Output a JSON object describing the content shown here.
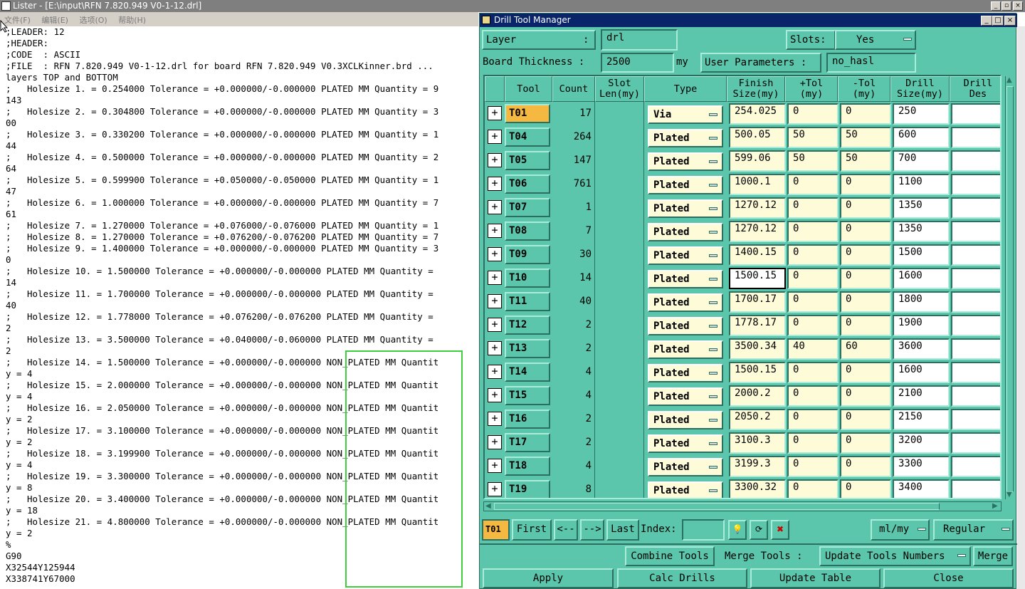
{
  "lister": {
    "title": "Lister - [E:\\input\\RFN 7.820.949 V0-1-12.drl]",
    "menu": [
      "文件(F)",
      "编辑(E)",
      "选项(O)",
      "帮助(H)"
    ],
    "lines": [
      ";LEADER: 12",
      ";HEADER:",
      ";CODE  : ASCII",
      ";FILE  : RFN 7.820.949 V0-1-12.drl for board RFN 7.820.949 V0.3XCLKinner.brd ...",
      "layers TOP and BOTTOM",
      ";   Holesize 1. = 0.254000 Tolerance = +0.000000/-0.000000 PLATED MM Quantity = 9",
      "143",
      ";   Holesize 2. = 0.304800 Tolerance = +0.000000/-0.000000 PLATED MM Quantity = 3",
      "00",
      ";   Holesize 3. = 0.330200 Tolerance = +0.000000/-0.000000 PLATED MM Quantity = 1",
      "44",
      ";   Holesize 4. = 0.500000 Tolerance = +0.000000/-0.000000 PLATED MM Quantity = 2",
      "64",
      ";   Holesize 5. = 0.599900 Tolerance = +0.050000/-0.050000 PLATED MM Quantity = 1",
      "47",
      ";   Holesize 6. = 1.000000 Tolerance = +0.000000/-0.000000 PLATED MM Quantity = 7",
      "61",
      ";   Holesize 7. = 1.270000 Tolerance = +0.076000/-0.076000 PLATED MM Quantity = 1",
      ";   Holesize 8. = 1.270000 Tolerance = +0.076200/-0.076200 PLATED MM Quantity = 7",
      ";   Holesize 9. = 1.400000 Tolerance = +0.000000/-0.000000 PLATED MM Quantity = 3",
      "0",
      ";   Holesize 10. = 1.500000 Tolerance = +0.000000/-0.000000 PLATED MM Quantity =",
      "14",
      ";   Holesize 11. = 1.700000 Tolerance = +0.000000/-0.000000 PLATED MM Quantity =",
      "40",
      ";   Holesize 12. = 1.778000 Tolerance = +0.076200/-0.076200 PLATED MM Quantity =",
      "2",
      ";   Holesize 13. = 3.500000 Tolerance = +0.040000/-0.060000 PLATED MM Quantity =",
      "2",
      ";   Holesize 14. = 1.500000 Tolerance = +0.000000/-0.000000 NON_PLATED MM Quantit",
      "y = 4",
      ";   Holesize 15. = 2.000000 Tolerance = +0.000000/-0.000000 NON_PLATED MM Quantit",
      "y = 4",
      ";   Holesize 16. = 2.050000 Tolerance = +0.000000/-0.000000 NON_PLATED MM Quantit",
      "y = 2",
      ";   Holesize 17. = 3.100000 Tolerance = +0.000000/-0.000000 NON_PLATED MM Quantit",
      "y = 2",
      ";   Holesize 18. = 3.199900 Tolerance = +0.000000/-0.000000 NON_PLATED MM Quantit",
      "y = 4",
      ";   Holesize 19. = 3.300000 Tolerance = +0.000000/-0.000000 NON_PLATED MM Quantit",
      "y = 8",
      ";   Holesize 20. = 3.400000 Tolerance = +0.000000/-0.000000 NON_PLATED MM Quantit",
      "y = 18",
      ";   Holesize 21. = 4.800000 Tolerance = +0.000000/-0.000000 NON_PLATED MM Quantit",
      "y = 2",
      "%",
      "G90",
      "X32544Y125944",
      "X338741Y67000"
    ]
  },
  "dtm": {
    "title": "Drill Tool Manager",
    "layer_label": "Layer",
    "layer_colon": ":",
    "layer_value": "drl",
    "slots_label": "Slots:",
    "slots_value": "Yes",
    "thickness_label": "Board Thickness :",
    "thickness_value": "2500",
    "thickness_unit": "my",
    "user_params_label": "User Parameters :",
    "user_params_value": "no_hasl",
    "headers": [
      {
        "l1": "Tool",
        "l2": ""
      },
      {
        "l1": "Count",
        "l2": ""
      },
      {
        "l1": "Slot",
        "l2": "Len(my)"
      },
      {
        "l1": "Type",
        "l2": ""
      },
      {
        "l1": "Finish",
        "l2": "Size(my)"
      },
      {
        "l1": "+Tol",
        "l2": "(my)"
      },
      {
        "l1": "-Tol",
        "l2": "(my)"
      },
      {
        "l1": "Drill",
        "l2": "Size(my)"
      },
      {
        "l1": "Drill",
        "l2": "Des"
      }
    ],
    "rows": [
      {
        "tool": "T01",
        "count": "17",
        "type": "Via",
        "finish": "254.025",
        "ptol": "0",
        "ntol": "0",
        "drill": "250"
      },
      {
        "tool": "T04",
        "count": "264",
        "type": "Plated",
        "finish": "500.05",
        "ptol": "50",
        "ntol": "50",
        "drill": "600"
      },
      {
        "tool": "T05",
        "count": "147",
        "type": "Plated",
        "finish": "599.06",
        "ptol": "50",
        "ntol": "50",
        "drill": "700"
      },
      {
        "tool": "T06",
        "count": "761",
        "type": "Plated",
        "finish": "1000.1",
        "ptol": "0",
        "ntol": "0",
        "drill": "1100"
      },
      {
        "tool": "T07",
        "count": "1",
        "type": "Plated",
        "finish": "1270.12",
        "ptol": "0",
        "ntol": "0",
        "drill": "1350"
      },
      {
        "tool": "T08",
        "count": "7",
        "type": "Plated",
        "finish": "1270.12",
        "ptol": "0",
        "ntol": "0",
        "drill": "1350"
      },
      {
        "tool": "T09",
        "count": "30",
        "type": "Plated",
        "finish": "1400.15",
        "ptol": "0",
        "ntol": "0",
        "drill": "1500"
      },
      {
        "tool": "T10",
        "count": "14",
        "type": "Plated",
        "finish": "1500.15",
        "ptol": "0",
        "ntol": "0",
        "drill": "1600"
      },
      {
        "tool": "T11",
        "count": "40",
        "type": "Plated",
        "finish": "1700.17",
        "ptol": "0",
        "ntol": "0",
        "drill": "1800"
      },
      {
        "tool": "T12",
        "count": "2",
        "type": "Plated",
        "finish": "1778.17",
        "ptol": "0",
        "ntol": "0",
        "drill": "1900"
      },
      {
        "tool": "T13",
        "count": "2",
        "type": "Plated",
        "finish": "3500.34",
        "ptol": "40",
        "ntol": "60",
        "drill": "3600"
      },
      {
        "tool": "T14",
        "count": "4",
        "type": "Plated",
        "finish": "1500.15",
        "ptol": "0",
        "ntol": "0",
        "drill": "1600"
      },
      {
        "tool": "T15",
        "count": "4",
        "type": "Plated",
        "finish": "2000.2",
        "ptol": "0",
        "ntol": "0",
        "drill": "2100"
      },
      {
        "tool": "T16",
        "count": "2",
        "type": "Plated",
        "finish": "2050.2",
        "ptol": "0",
        "ntol": "0",
        "drill": "2150"
      },
      {
        "tool": "T17",
        "count": "2",
        "type": "Plated",
        "finish": "3100.3",
        "ptol": "0",
        "ntol": "0",
        "drill": "3200"
      },
      {
        "tool": "T18",
        "count": "4",
        "type": "Plated",
        "finish": "3199.3",
        "ptol": "0",
        "ntol": "0",
        "drill": "3300"
      },
      {
        "tool": "T19",
        "count": "8",
        "type": "Plated",
        "finish": "3300.32",
        "ptol": "0",
        "ntol": "0",
        "drill": "3400"
      }
    ],
    "nav": {
      "current": "T01",
      "first": "First",
      "prev": "<--",
      "next": "-->",
      "last": "Last",
      "index_label": "Index:",
      "units": "ml/my",
      "mode": "Regular"
    },
    "actions": {
      "combine": "Combine Tools",
      "merge_label": "Merge Tools :",
      "merge_option": "Update Tools Numbers",
      "merge": "Merge",
      "apply": "Apply",
      "calc": "Calc Drills",
      "update": "Update Table",
      "close": "Close"
    },
    "colors": {
      "panel": "#5bc6ab",
      "selected_tool": "#f5b942",
      "field": "#fdfbd8",
      "highlight_box": "#3ecf3e"
    }
  }
}
